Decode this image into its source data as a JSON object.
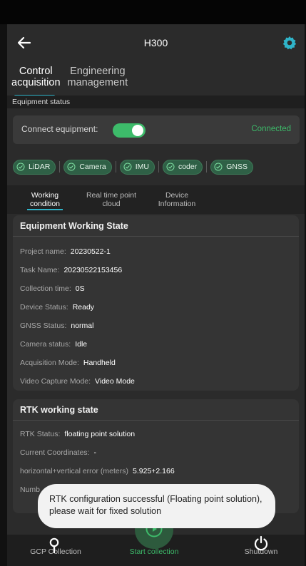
{
  "header": {
    "title": "H300"
  },
  "main_tabs": [
    {
      "line1": "Control",
      "line2": "acquisition"
    },
    {
      "line1": "Engineering",
      "line2": "management"
    }
  ],
  "section": {
    "equipment_status": "Equipment status"
  },
  "connect": {
    "label": "Connect equipment:",
    "status": "Connected",
    "enabled": true
  },
  "chips": [
    "LiDAR",
    "Camera",
    "IMU",
    "coder",
    "GNSS"
  ],
  "sub_tabs": [
    {
      "line1": "Working",
      "line2": "condition"
    },
    {
      "line1": "Real time point",
      "line2": "cloud"
    },
    {
      "line1": "Device",
      "line2": "Information"
    }
  ],
  "working_state": {
    "title": "Equipment Working State",
    "rows": [
      {
        "label": "Project name:",
        "value": "20230522-1"
      },
      {
        "label": "Task Name:",
        "value": "20230522153456"
      },
      {
        "label": "Collection time:",
        "value": "0S"
      },
      {
        "label": "Device Status:",
        "value": "Ready"
      },
      {
        "label": "GNSS Status:",
        "value": "normal"
      },
      {
        "label": "Camera status:",
        "value": "Idle"
      },
      {
        "label": "Acquisition Mode:",
        "value": "Handheld"
      },
      {
        "label": "Video Capture Mode:",
        "value": "Video Mode"
      }
    ]
  },
  "rtk": {
    "title": "RTK working state",
    "rows": [
      {
        "label": "RTK Status:",
        "value": "floating point solution"
      },
      {
        "label": "Current Coordinates:",
        "value": "-"
      },
      {
        "label": "horizontal+vertical error (meters)",
        "value": "5.925+2.166"
      },
      {
        "label": "Numb",
        "value": ""
      }
    ]
  },
  "toast": {
    "message": "RTK configuration successful (Floating point solution), please wait for fixed solution"
  },
  "bottom_nav": {
    "gcp": "GCP Collection",
    "start": "Start collection",
    "shutdown": "Shutdown"
  },
  "colors": {
    "accent": "#2fb4c9",
    "success": "#3dbb6a"
  }
}
